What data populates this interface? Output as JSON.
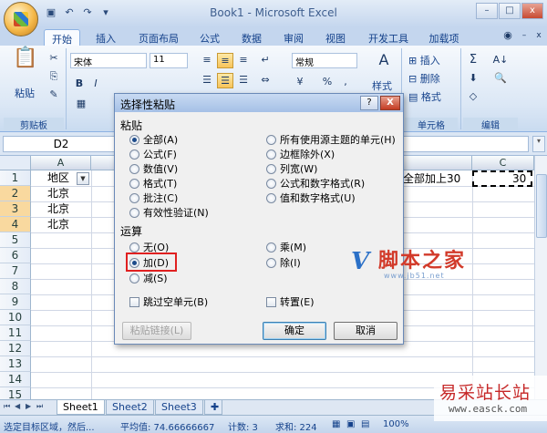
{
  "window": {
    "title": "Book1 - Microsoft Excel",
    "controls": [
      "–",
      "□",
      "x"
    ]
  },
  "ribbon": {
    "tabs": [
      "开始",
      "插入",
      "页面布局",
      "公式",
      "数据",
      "审阅",
      "视图",
      "开发工具",
      "加载项"
    ],
    "active_tab": "开始",
    "groups": {
      "clipboard": "剪贴板",
      "cells": "单元格",
      "editing": "编辑"
    },
    "paste_label": "粘贴",
    "font_name": "宋体",
    "font_size": "11",
    "number_format": "常规",
    "style_label": "样式",
    "insert_label": "插入",
    "delete_label": "删除",
    "format_label": "格式",
    "percent": "%",
    "comma": ","
  },
  "formula_bar": {
    "name_box": "D2"
  },
  "sheet": {
    "columns": [
      "A",
      "C"
    ],
    "rows": [
      "1",
      "2",
      "3",
      "4",
      "5",
      "6",
      "7",
      "8",
      "9",
      "10",
      "11",
      "12",
      "13",
      "14",
      "15"
    ],
    "cells": {
      "A1": "地区",
      "A2": "北京",
      "A3": "北京",
      "A4": "北京",
      "B_partial_1": "全部加上30",
      "C1": "30"
    },
    "tabs": [
      "Sheet1",
      "Sheet2",
      "Sheet3"
    ],
    "active_tab": "Sheet1"
  },
  "status_bar": {
    "message": "选定目标区域，然后...",
    "average": "平均值: 74.66666667",
    "count": "计数: 3",
    "sum": "求和: 224",
    "zoom": "100%"
  },
  "dialog": {
    "title": "选择性粘贴",
    "help": "?",
    "close": "X",
    "paste_section": "粘贴",
    "paste_options_left": [
      "全部(A)",
      "公式(F)",
      "数值(V)",
      "格式(T)",
      "批注(C)",
      "有效性验证(N)"
    ],
    "paste_options_right": [
      "所有使用源主题的单元(H)",
      "边框除外(X)",
      "列宽(W)",
      "公式和数字格式(R)",
      "值和数字格式(U)"
    ],
    "paste_selected": "全部(A)",
    "operation_section": "运算",
    "operation_left": [
      "无(O)",
      "加(D)",
      "减(S)"
    ],
    "operation_right": [
      "乘(M)",
      "除(I)"
    ],
    "operation_selected": "加(D)",
    "skip_blanks": "跳过空单元(B)",
    "transpose": "转置(E)",
    "paste_link": "粘贴链接(L)",
    "ok": "确定",
    "cancel": "取消"
  },
  "watermarks": {
    "jb51_cn": "脚本之家",
    "jb51_logo": "V",
    "jb51_url": "www.jb51.net",
    "easck_cn": "易采站长站",
    "easck_url": "www.easck.com"
  }
}
